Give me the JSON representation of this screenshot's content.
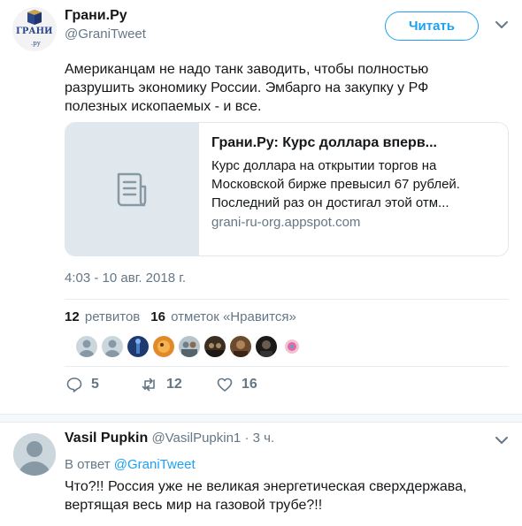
{
  "tweet": {
    "author_name": "Грани.Ру",
    "author_handle": "@GraniTweet",
    "avatar_logo_text": "ГРАНИ",
    "avatar_logo_sub": ".ру",
    "follow_label": "Читать",
    "text": "Американцам не надо танк заводить, чтобы полностью разрушить экономику России. Эмбарго на закупку у РФ полезных ископаемых - и все.",
    "card": {
      "title": "Грани.Ру: Курс доллара вперв...",
      "description": "Курс доллара на открытии торгов на Московской бирже превысил 67 рублей. Последний раз он достигал этой отм...",
      "domain": "grani-ru-org.appspot.com"
    },
    "timestamp": "4:03 - 10 авг. 2018 г.",
    "retweets_count": "12",
    "retweets_label": "ретвитов",
    "likes_count": "16",
    "likes_label": "отметок «Нравится»",
    "likers": [
      "default",
      "default",
      "blue-figure",
      "orange",
      "group",
      "dark-group",
      "brown",
      "dark-person",
      "pink-art"
    ],
    "actions": {
      "reply_count": "5",
      "retweet_count": "12",
      "like_count": "16"
    }
  },
  "reply": {
    "author_name": "Vasil Pupkin",
    "author_handle": "@VasilPupkin1",
    "dot": "·",
    "time": "3 ч.",
    "in_reply_prefix": "В ответ",
    "in_reply_to": "@GraniTweet",
    "text": "Что?!! Россия уже не великая энергетическая сверхдержава, вертящая весь мир на газовой трубе?!!"
  },
  "colors": {
    "accent": "#1da1f2",
    "muted": "#657786",
    "text": "#14171a",
    "border": "#e1e8ed"
  }
}
